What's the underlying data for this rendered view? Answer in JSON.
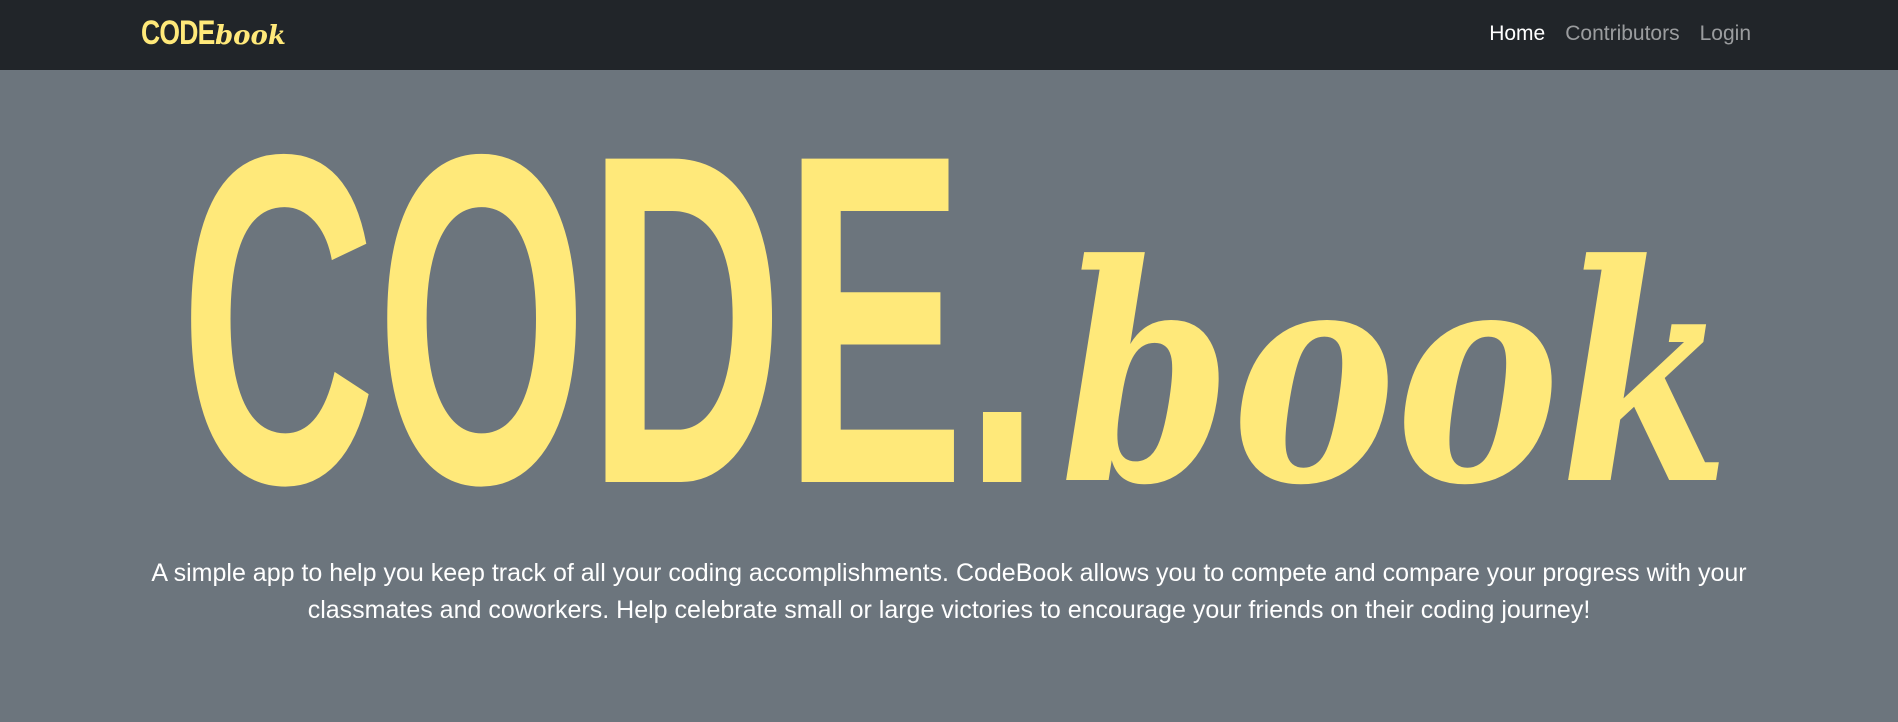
{
  "navbar": {
    "brand": {
      "code": "CODE.",
      "book": "book"
    },
    "links": [
      {
        "label": "Home",
        "active": true
      },
      {
        "label": "Contributors",
        "active": false
      },
      {
        "label": "Login",
        "active": false
      }
    ]
  },
  "hero": {
    "logo": {
      "code": "CODE.",
      "book": "book"
    },
    "tagline": "A simple app to help you keep track of all your coding accomplishments. CodeBook allows you to compete and compare your progress with your classmates and coworkers. Help celebrate small or large victories to encourage your friends on their coding journey!"
  },
  "colors": {
    "accent": "#ffe97a",
    "navbar_bg": "#212529",
    "page_bg": "#6c757d",
    "text": "#ffffff"
  }
}
